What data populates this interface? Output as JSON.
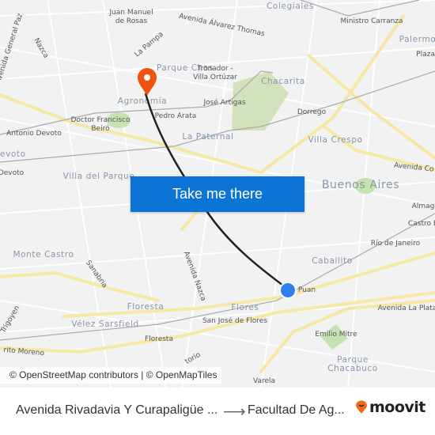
{
  "map": {
    "labels": [
      {
        "text": "Colegiales",
        "kind": "neighborhood"
      },
      {
        "text": "Juan Manuel",
        "kind": "street"
      },
      {
        "text": "de Rosas",
        "kind": "street"
      },
      {
        "text": "Avenida Álvarez Thomas",
        "kind": "street"
      },
      {
        "text": "Ministro Carranza",
        "kind": "street"
      },
      {
        "text": "Palermo",
        "kind": "neighborhood"
      },
      {
        "text": "Plaza",
        "kind": "street"
      },
      {
        "text": "Nazca",
        "kind": "street"
      },
      {
        "text": "Avenida General Paz",
        "kind": "street"
      },
      {
        "text": "La Pampa",
        "kind": "street"
      },
      {
        "text": "Parque Chas",
        "kind": "neighborhood"
      },
      {
        "text": "Tronador -",
        "kind": "street"
      },
      {
        "text": "Villa Ortúzar",
        "kind": "street"
      },
      {
        "text": "Chacarita",
        "kind": "neighborhood"
      },
      {
        "text": "Agronomía",
        "kind": "neighborhood"
      },
      {
        "text": "José Artigas",
        "kind": "street"
      },
      {
        "text": "Doctor Francisco",
        "kind": "street"
      },
      {
        "text": "Beiró",
        "kind": "street"
      },
      {
        "text": "Pedro Arata",
        "kind": "street"
      },
      {
        "text": "Antonio Devoto",
        "kind": "street"
      },
      {
        "text": "Dorrego",
        "kind": "street"
      },
      {
        "text": "La Paternal",
        "kind": "neighborhood"
      },
      {
        "text": "Villa Crespo",
        "kind": "neighborhood"
      },
      {
        "text": "Devoto",
        "kind": "neighborhood"
      },
      {
        "text": "Avenida Co",
        "kind": "street"
      },
      {
        "text": "Devoto",
        "kind": "street"
      },
      {
        "text": "Villa del Parque",
        "kind": "neighborhood"
      },
      {
        "text": "Buenos Aires",
        "kind": "neighborhood"
      },
      {
        "text": "Almag",
        "kind": "street"
      },
      {
        "text": "Castro B",
        "kind": "street"
      },
      {
        "text": "Río de Janeiro",
        "kind": "street"
      },
      {
        "text": "Monte Castro",
        "kind": "neighborhood"
      },
      {
        "text": "Sanabria",
        "kind": "street"
      },
      {
        "text": "Avenida Nazca",
        "kind": "street"
      },
      {
        "text": "Caballito",
        "kind": "neighborhood"
      },
      {
        "text": "Puan",
        "kind": "street"
      },
      {
        "text": "Floresta",
        "kind": "neighborhood"
      },
      {
        "text": "Flores",
        "kind": "neighborhood"
      },
      {
        "text": "Avenida La Plata",
        "kind": "street"
      },
      {
        "text": "Vélez Sarsfield",
        "kind": "neighborhood"
      },
      {
        "text": "San José de Flores",
        "kind": "street"
      },
      {
        "text": "Trigoyen",
        "kind": "street"
      },
      {
        "text": "Emilio Mitre",
        "kind": "street"
      },
      {
        "text": "Floresta",
        "kind": "street"
      },
      {
        "text": "rito Moreno",
        "kind": "street"
      },
      {
        "text": "Parque",
        "kind": "neighborhood"
      },
      {
        "text": "Chacabuco",
        "kind": "neighborhood"
      },
      {
        "text": "Varela",
        "kind": "street"
      },
      {
        "text": "torio",
        "kind": "street"
      }
    ],
    "destination_pin_color": "#f0520f",
    "origin_dot_color": "#2f80ed",
    "route_color": "#222222",
    "attribution": "© OpenStreetMap contributors | © OpenMapTiles"
  },
  "cta": {
    "label": "Take me there",
    "color": "#0c74d4"
  },
  "footer": {
    "from": "Avenida Rivadavia Y Curapaligüe ...",
    "arrow": "⟶",
    "to": "Facultad De Ag...",
    "logo": "moovit",
    "logo_color": "#f26b1d"
  }
}
